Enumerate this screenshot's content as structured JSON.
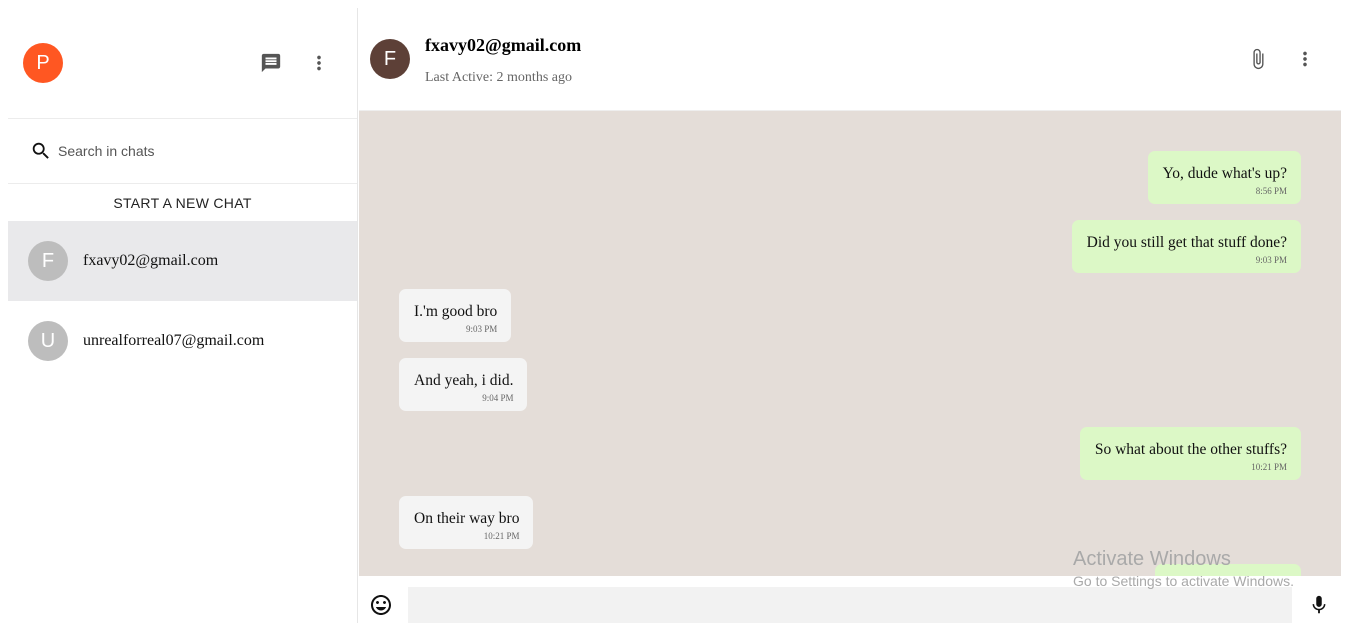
{
  "sidebar": {
    "user_avatar_letter": "P",
    "user_avatar_color": "#ff5722",
    "search_placeholder": "Search in chats",
    "new_chat_label": "START A NEW CHAT",
    "chats": [
      {
        "letter": "F",
        "name": "fxavy02@gmail.com",
        "active": true
      },
      {
        "letter": "U",
        "name": "unrealforreal07@gmail.com",
        "active": false
      }
    ],
    "icons": {
      "new_chat": "chat-icon",
      "more": "more-vert-icon",
      "search": "search-icon"
    }
  },
  "conversation": {
    "peer_avatar_letter": "F",
    "peer_avatar_color": "#5d4037",
    "peer_name": "fxavy02@gmail.com",
    "peer_status": "Last Active: 2 months ago",
    "icons": {
      "attach": "paperclip-icon",
      "more": "more-vert-icon"
    },
    "messages": [
      {
        "direction": "out",
        "text": "Yo, dude what's up?",
        "time": "8:56 PM"
      },
      {
        "direction": "out",
        "text": "Did you still get that stuff done?",
        "time": "9:03 PM"
      },
      {
        "direction": "in",
        "text": "I.'m good bro",
        "time": "9:03 PM"
      },
      {
        "direction": "in",
        "text": "And yeah, i did.",
        "time": "9:04 PM"
      },
      {
        "direction": "out",
        "text": "So what about the other stuffs?",
        "time": "10:21 PM"
      },
      {
        "direction": "in",
        "text": "On their way bro",
        "time": "10:21 PM"
      }
    ]
  },
  "composer": {
    "message_value": "",
    "icons": {
      "emoji": "emoji-icon",
      "mic": "mic-icon"
    }
  },
  "watermark": {
    "title": "Activate Windows",
    "subtitle": "Go to Settings to activate Windows."
  },
  "colors": {
    "outgoing_bubble": "#dcf8c6",
    "incoming_bubble": "#f4f4f4",
    "chat_background": "#e4ddd8",
    "active_chat": "#e9e9eb"
  }
}
